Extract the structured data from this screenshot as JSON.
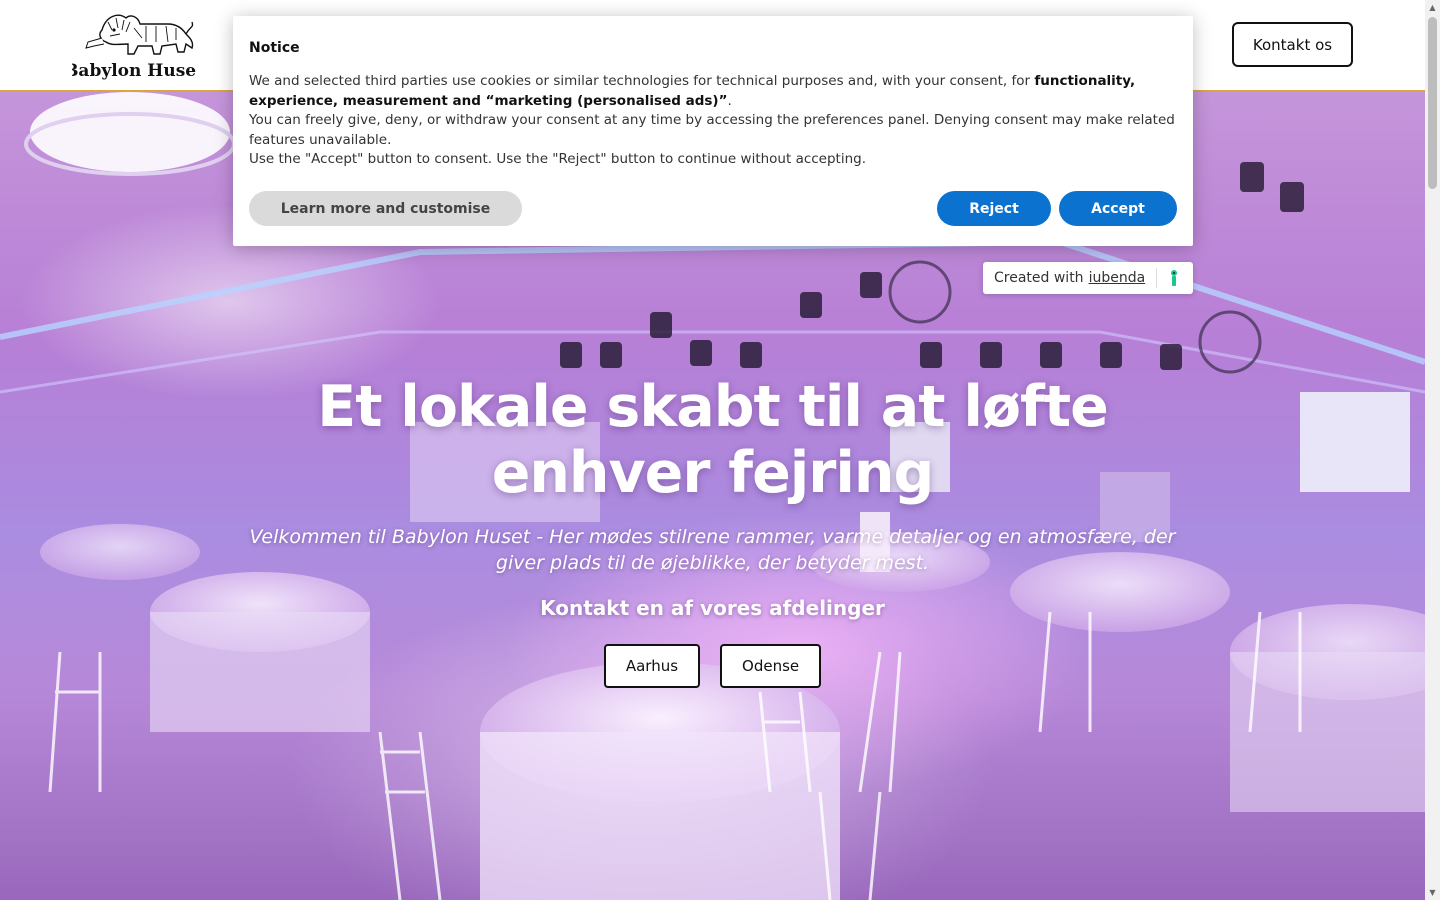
{
  "header": {
    "logo_text": "Babylon Huset",
    "contact_label": "Kontakt os"
  },
  "hero": {
    "title": "Et lokale skabt til at løfte enhver fejring",
    "subtitle": "Velkommen til Babylon Huset - Her mødes stilrene rammer, varme detaljer og en atmosfære, der giver plads til de øjeblikke, der betyder mest.",
    "cta_label": "Kontakt en af vores afdelinger",
    "departments": [
      "Aarhus",
      "Odense"
    ]
  },
  "notice": {
    "title": "Notice",
    "line1_prefix": "We and selected third parties use cookies or similar technologies for technical purposes and, with your consent, for ",
    "line1_bold": "functionality, experience, measurement and “marketing (personalised ads)”",
    "line1_suffix": ".",
    "line2": "You can freely give, deny, or withdraw your consent at any time by accessing the preferences panel. Denying consent may make related features unavailable.",
    "line3": "Use the \"Accept\" button to consent. Use the \"Reject\" button to continue without accepting.",
    "learn_more_label": "Learn more and customise",
    "reject_label": "Reject",
    "accept_label": "Accept"
  },
  "badge": {
    "prefix": "Created with",
    "link": "iubenda"
  },
  "icons": {
    "logo": "lion-logo-icon",
    "badge": "iubenda-keyhole-icon",
    "scroll_up": "scroll-up-arrow-icon",
    "scroll_down": "scroll-down-arrow-icon"
  },
  "colors": {
    "accent_blue": "#0b73cf",
    "header_border": "#d9a441",
    "iubenda_green": "#1cc691"
  }
}
